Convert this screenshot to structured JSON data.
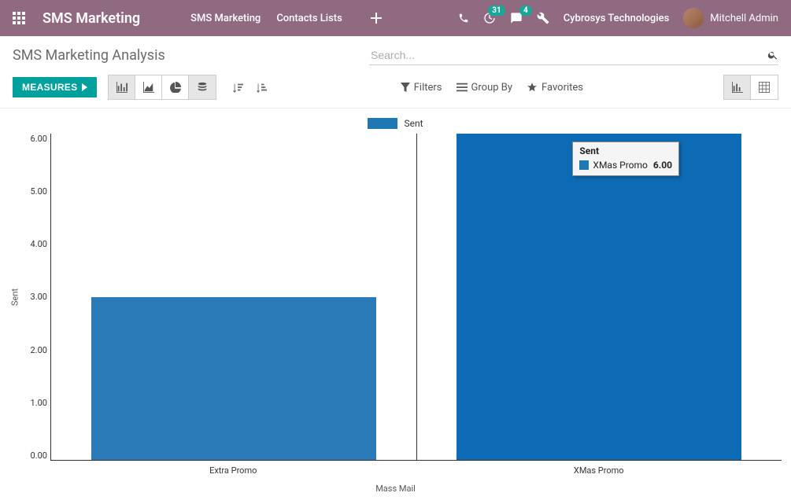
{
  "navbar": {
    "brand": "SMS Marketing",
    "links": [
      "SMS Marketing",
      "Contacts Lists"
    ],
    "badges": {
      "activity": "31",
      "messages": "4"
    },
    "company": "Cybrosys Technologies",
    "user": "Mitchell Admin"
  },
  "breadcrumb": {
    "title": "SMS Marketing Analysis"
  },
  "search": {
    "placeholder": "Search..."
  },
  "toolbar": {
    "measures_label": "MEASURES",
    "filters": "Filters",
    "group_by": "Group By",
    "favorites": "Favorites"
  },
  "chart_data": {
    "type": "bar",
    "legend": "Sent",
    "ylabel": "Sent",
    "xlabel": "Mass Mail",
    "y_ticks": [
      "6.00",
      "5.00",
      "4.00",
      "3.00",
      "2.00",
      "1.00",
      "0.00"
    ],
    "ylim": [
      0,
      6
    ],
    "categories": [
      "Extra Promo",
      "XMas Promo"
    ],
    "values": [
      3,
      6
    ],
    "series": [
      {
        "name": "Sent",
        "values": [
          3,
          6
        ]
      }
    ]
  },
  "tooltip": {
    "title": "Sent",
    "label": "XMas Promo",
    "value": "6.00"
  }
}
